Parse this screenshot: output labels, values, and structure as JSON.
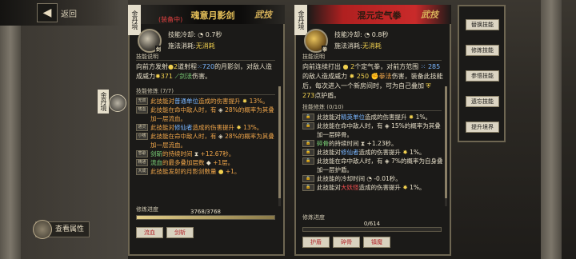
{
  "nav": {
    "back_label": "返回",
    "back_icon": "left-arrow-icon"
  },
  "side_character": {
    "label": "金丹境"
  },
  "view_attributes": {
    "label": "查看属性"
  },
  "left_panel": {
    "realm": "金丹境",
    "skill_name": "魂意月影剑",
    "equipped": "(装备中)",
    "style": "武技",
    "icon_badge": "剑",
    "cooldown_label": "技能冷却:",
    "cooldown_value": "0.7秒",
    "cost_label": "施法消耗:",
    "cost_value": "无消耗",
    "desc_title": "技能说明",
    "desc_part1": "向前方发射",
    "desc_count": "2",
    "desc_part2": "道射程",
    "desc_range": "720",
    "desc_part3": "的月影剑，对敌人造成威力",
    "desc_power": "371",
    "desc_type": "剑法",
    "desc_part4": "伤害。",
    "train_title": "技能修炼 (7/7)",
    "lines": [
      {
        "icon": "无双",
        "a": "此技能对",
        "hl": "普通单位",
        "b": "造成的伤害提升",
        "c": "13%。"
      },
      {
        "icon": "嗜血",
        "a": "此技能在命中敌人时，有",
        "hl": "",
        "b": "28%的概率为其叠加一层流血。",
        "c": ""
      },
      {
        "icon": "通灵",
        "a": "此技能对",
        "hl": "修仙者",
        "b": "造成的伤害提升",
        "c": "13%。"
      },
      {
        "icon": "小嗜",
        "a": "此技能在命中敌人时，有",
        "hl": "",
        "b": "28%的概率为其叠加一层流血。",
        "c": ""
      },
      {
        "icon": "悲歌",
        "a": "剑斩",
        "hl": "",
        "b": "的持续时间",
        "c": "+12.67秒。"
      },
      {
        "icon": "精通",
        "a": "流血",
        "hl": "",
        "b": "的最多叠加层数",
        "c": "+1层。"
      },
      {
        "icon": "大成",
        "a": "此技能发射的月影剑数量",
        "hl": "",
        "b": "",
        "c": "+1。"
      }
    ],
    "progress_label": "修炼进度",
    "progress_text": "3768/3768",
    "progress_fraction": 1.0,
    "tags": [
      "流血",
      "剑斩"
    ]
  },
  "right_panel": {
    "realm": "金丹境",
    "skill_name": "混元定气拳",
    "style": "武技",
    "icon_badge": "拳",
    "cooldown_label": "技能冷却:",
    "cooldown_value": "0.8秒",
    "cost_label": "施法消耗:",
    "cost_value": "无消耗",
    "desc_title": "技能说明",
    "desc_part1": "向前连续打出",
    "desc_count": "2",
    "desc_part2": "个定气拳，对前方范围",
    "desc_range": "285",
    "desc_part3": "的敌人造成威力",
    "desc_power": "250",
    "desc_type": "拳法",
    "desc_part4": "伤害，装备此技能后，每次进入一个新房间时，可为自己叠加",
    "desc_shield": "273",
    "desc_part5": "点护盾。",
    "train_title": "技能修炼 (0/10)",
    "lines": [
      {
        "icon": "",
        "a": "此技能对",
        "hl": "精英单位",
        "b": "造成的伤害提升",
        "c": "1%。"
      },
      {
        "icon": "",
        "a": "此技能在命中敌人时，有",
        "hl": "",
        "b": "15%的概率为其叠加一层碎骨。",
        "c": ""
      },
      {
        "icon": "",
        "a": "碎骨",
        "hl": "",
        "b": "的持续时间",
        "c": "+1.23秒。"
      },
      {
        "icon": "",
        "a": "此技能对",
        "hl": "修仙者",
        "b": "造成的伤害提升",
        "c": "1%。"
      },
      {
        "icon": "",
        "a": "此技能在命中敌人时，有",
        "hl": "",
        "b": "7%的概率为自身叠加一层护盾。",
        "c": ""
      },
      {
        "icon": "",
        "a": "此技能的冷却时间",
        "hl": "",
        "b": "",
        "c": "-0.01秒。"
      },
      {
        "icon": "",
        "a": "此技能对",
        "hl": "大妖怪",
        "b": "造成的伤害提升",
        "c": "1%。"
      }
    ],
    "progress_label": "修炼进度",
    "progress_text": "0/614",
    "progress_fraction": 0.0,
    "tags": [
      "护盾",
      "碎骨",
      "镇魔"
    ]
  },
  "menu": {
    "buttons": [
      "替换技能",
      "修炼技能",
      "参悟技能",
      "遗忘技能",
      "提升境界"
    ]
  },
  "colors": {
    "red_title": "#c92a2a",
    "gold": "#f2d14f",
    "blue_keyword": "#7ab7ff",
    "orange_text": "#f0a64a"
  }
}
